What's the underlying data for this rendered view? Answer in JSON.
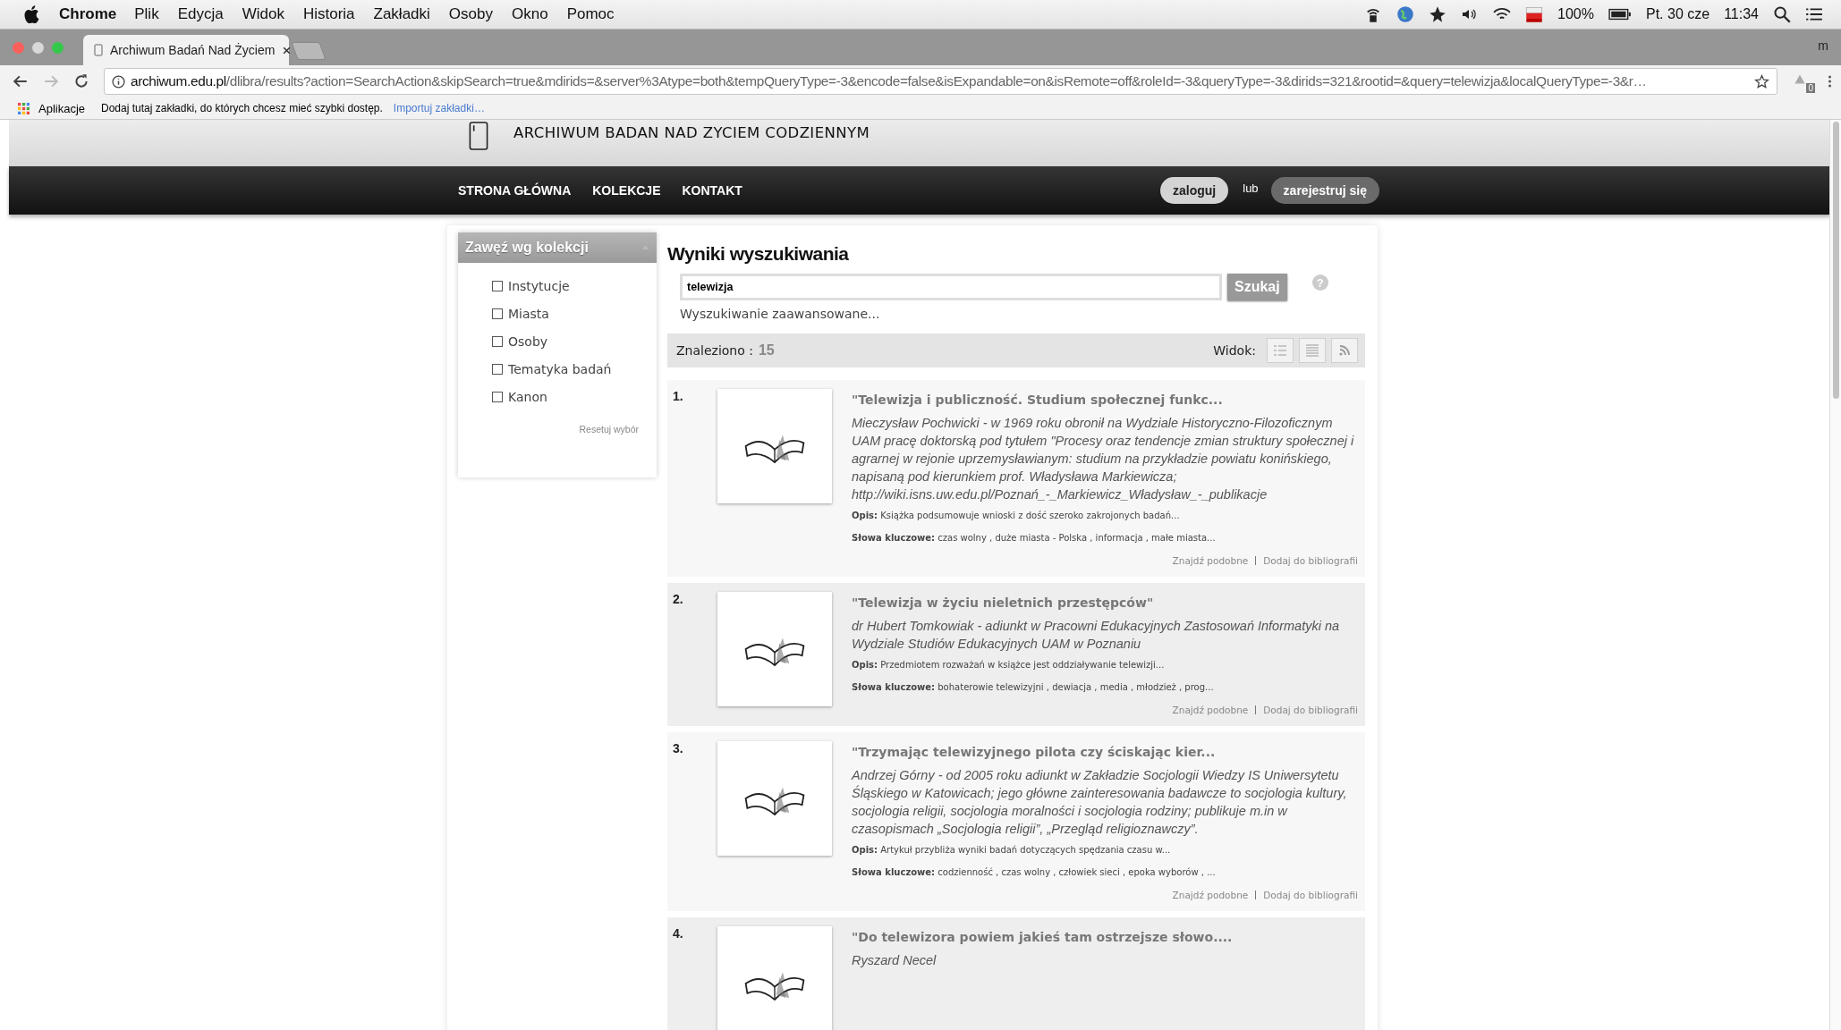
{
  "menubar": {
    "app": "Chrome",
    "items": [
      "Plik",
      "Edycja",
      "Widok",
      "Historia",
      "Zakładki",
      "Osoby",
      "Okno",
      "Pomoc"
    ],
    "battery": "100%",
    "date": "Pt. 30 cze",
    "time": "11:34"
  },
  "browser": {
    "tab_title": "Archiwum Badań Nad Życiem",
    "profile": "m",
    "url_host": "archiwum.edu.pl",
    "url_rest": "/dlibra/results?action=SearchAction&skipSearch=true&mdirids=&server%3Atype=both&tempQueryType=-3&encode=false&isExpandable=on&isRemote=off&roleId=-3&queryType=-3&dirids=321&rootid=&query=telewizja&localQueryType=-3&r…",
    "extension_badge": "0",
    "bookmarks": {
      "apps": "Aplikacje",
      "hint": "Dodaj tutaj zakładki, do których chcesz mieć szybki dostęp.",
      "import": "Importuj zakładki…"
    }
  },
  "site": {
    "title": "ARCHIWUM BADAN NAD ZYCIEM CODZIENNYM",
    "nav": [
      "STRONA GŁÓWNA",
      "KOLEKCJE",
      "KONTAKT"
    ],
    "login": "zaloguj",
    "or": "lub",
    "register": "zarejestruj się"
  },
  "sidebar": {
    "title": "Zawęź wg kolekcji",
    "items": [
      {
        "label": "Instytucje",
        "checked": false
      },
      {
        "label": "Miasta",
        "checked": false
      },
      {
        "label": "Osoby",
        "checked": false
      },
      {
        "label": "Tematyka badań",
        "checked": false
      },
      {
        "label": "Kanon",
        "checked": false
      }
    ],
    "reset": "Resetuj wybór"
  },
  "search": {
    "heading": "Wyniki wyszukiwania",
    "value": "telewizja",
    "button": "Szukaj",
    "help": "?",
    "advanced": "Wyszukiwanie zaawansowane...",
    "found_label": "Znaleziono :",
    "found_count": "15",
    "view_label": "Widok:"
  },
  "results": [
    {
      "number": "1.",
      "title": "\"Telewizja i publiczność. Studium społecznej funkc...",
      "author": "Mieczysław Pochwicki - w 1969 roku obronił na Wydziale Historyczno-Filozoficznym UAM pracę doktorską pod tytułem \"Procesy oraz tendencje zmian struktury społecznej i agrarnej w rejonie uprzemysławianym: studium na przykładzie powiatu konińskiego, napisaną pod kierunkiem prof. Władysława Markiewicza; http://wiki.isns.uw.edu.pl/Poznań_-_Markiewicz_Władysław_-_publikacje",
      "description_label": "Opis:",
      "description": "Książka podsumowuje wnioski z dość szeroko zakrojonych badań...",
      "keywords_label": "Słowa kluczowe:",
      "keywords": "czas wolny , duże miasta - Polska , informacja , małe miasta...",
      "actions": [
        "Znajdź podobne",
        "Dodaj do bibliografii"
      ]
    },
    {
      "number": "2.",
      "title": "\"Telewizja w życiu nieletnich przestępców\"",
      "author": "dr Hubert Tomkowiak - adiunkt w Pracowni Edukacyjnych Zastosowań Informatyki na Wydziale Studiów Edukacyjnych UAM w Poznaniu",
      "description_label": "Opis:",
      "description": "Przedmiotem rozważań w książce jest oddziaływanie telewizji...",
      "keywords_label": "Słowa kluczowe:",
      "keywords": "bohaterowie telewizyjni , dewiacja , media , młodzież , prog...",
      "actions": [
        "Znajdź podobne",
        "Dodaj do bibliografii"
      ]
    },
    {
      "number": "3.",
      "title": "\"Trzymając telewizyjnego pilota czy ściskając kier...",
      "author": "Andrzej Górny - od 2005 roku adiunkt w Zakładzie Socjologii Wiedzy IS Uniwersytetu Śląskiego w Katowicach; jego główne zainteresowania badawcze to socjologia kultury, socjologia religii, socjologia moralności i socjologia rodziny; publikuje m.in w czasopismach „Socjologia religii”, „Przegląd religioznawczy”.",
      "description_label": "Opis:",
      "description": "Artykuł przybliża wyniki badań dotyczących spędzania czasu w...",
      "keywords_label": "Słowa kluczowe:",
      "keywords": "codzienność , czas wolny , człowiek sieci , epoka wyborów , ...",
      "actions": [
        "Znajdź podobne",
        "Dodaj do bibliografii"
      ]
    },
    {
      "number": "4.",
      "title": "\"Do telewizora powiem jakieś tam ostrzejsze słowo....",
      "author": "Ryszard Necel"
    }
  ]
}
